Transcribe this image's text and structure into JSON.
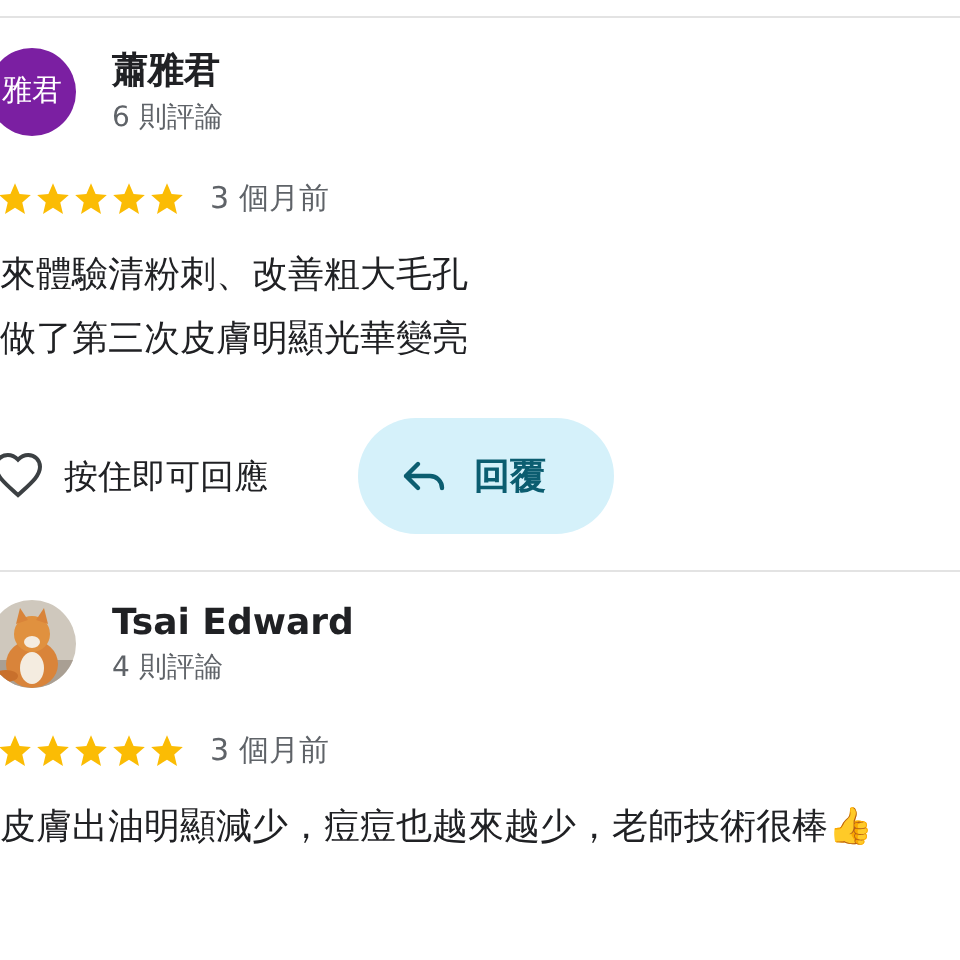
{
  "reviews": [
    {
      "avatar": {
        "kind": "initials",
        "text": "雅君"
      },
      "name": "蕭雅君",
      "review_count": "6 則評論",
      "stars": 5,
      "time": "3 個月前",
      "lines": [
        "來體驗清粉刺、改善粗大毛孔",
        "做了第三次皮膚明顯光華變亮"
      ],
      "actions": {
        "like_label": "按住即可回應",
        "reply_label": "回覆"
      }
    },
    {
      "avatar": {
        "kind": "picture"
      },
      "name": "Tsai Edward",
      "review_count": "4 則評論",
      "stars": 5,
      "time": "3 個月前",
      "lines": [
        "皮膚出油明顯減少，痘痘也越來越少，老師技術很棒👍"
      ]
    }
  ]
}
